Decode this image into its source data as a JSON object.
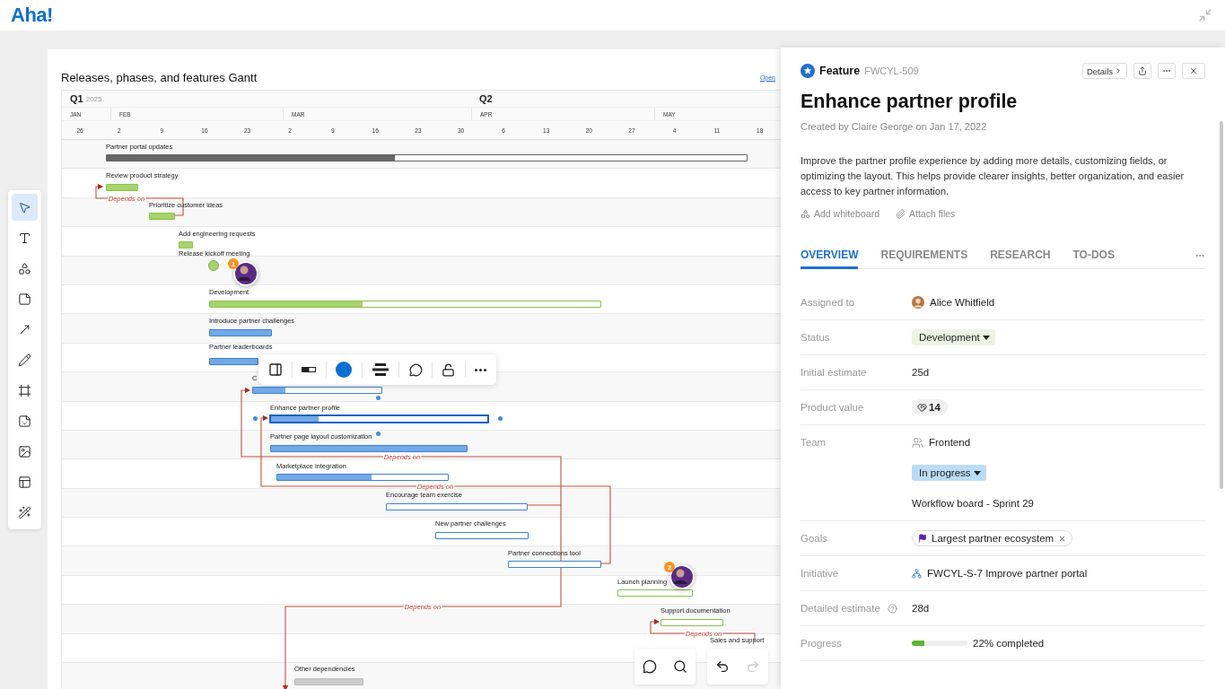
{
  "app": {
    "logo": "Aha!"
  },
  "tools": [
    {
      "selected": true
    },
    {
      "selected": false
    },
    {
      "selected": false
    },
    {
      "selected": false
    },
    {
      "selected": false
    },
    {
      "selected": false
    },
    {
      "selected": false
    },
    {
      "selected": false
    },
    {
      "selected": false
    },
    {
      "selected": false
    },
    {
      "selected": false
    }
  ],
  "gantt": {
    "title": "Releases, phases, and features Gantt",
    "open_link": "Open",
    "quarters": [
      {
        "label": "Q1",
        "year": "2025"
      },
      {
        "label": "Q2"
      }
    ],
    "months": [
      "JAN",
      "FEB",
      "MAR",
      "APR",
      "MAY"
    ],
    "days": [
      "26",
      "2",
      "9",
      "16",
      "23",
      "2",
      "9",
      "16",
      "23",
      "30",
      "6",
      "13",
      "20",
      "27",
      "4",
      "11",
      "18"
    ],
    "items": [
      {
        "label": "Partner portal updates",
        "kind": "release",
        "level": 0.45,
        "selected": false
      },
      {
        "label": "Review product strategy",
        "kind": "phase",
        "level": 1,
        "selected": false
      },
      {
        "label": "Prioritize customer ideas",
        "kind": "phase",
        "level": 1,
        "selected": false
      },
      {
        "label": "Add engineering requests",
        "kind": "phase",
        "level": 1,
        "selected": false
      },
      {
        "label": "Release kickoff meeting",
        "kind": "milestone",
        "badge": "1"
      },
      {
        "label": "Development",
        "kind": "phase",
        "level": 0.39,
        "selected": false
      },
      {
        "label": "Introduce partner challenges",
        "kind": "feature",
        "level": 1,
        "selected": false
      },
      {
        "label": "Partner leaderboards",
        "kind": "feature",
        "level": 1,
        "selected": false
      },
      {
        "label": "C",
        "kind": "feature",
        "level": 0.25,
        "selected": false
      },
      {
        "label": "Enhance partner profile",
        "kind": "feature",
        "level": 0.22,
        "selected": true
      },
      {
        "label": "Partner page layout customization",
        "kind": "feature",
        "level": 1,
        "selected": false
      },
      {
        "label": "Marketplace integration",
        "kind": "feature",
        "level": 0.55,
        "selected": false
      },
      {
        "label": "Encourage team exercise",
        "kind": "feature",
        "level": 0,
        "selected": false
      },
      {
        "label": "New partner challenges",
        "kind": "feature",
        "level": 0,
        "selected": false
      },
      {
        "label": "Partner connections tool",
        "kind": "feature",
        "level": 0,
        "selected": false
      },
      {
        "label": "Launch planning",
        "kind": "phase",
        "level": 0,
        "badge": "2",
        "selected": false
      },
      {
        "label": "Support documentation",
        "kind": "phase",
        "level": 0,
        "selected": false
      },
      {
        "label": "Sales and support",
        "kind": "label"
      },
      {
        "label": "Other dependencies",
        "kind": "other",
        "level": 1,
        "selected": false
      }
    ],
    "dependencies": [
      {
        "label": "Depends on"
      },
      {
        "label": "Depends on"
      },
      {
        "label": "Depends on"
      },
      {
        "label": "Depends on"
      },
      {
        "label": "Depends on"
      }
    ]
  },
  "bar_toolbar": {
    "color": "#0b6fd6"
  },
  "history": {
    "undo_disabled": false,
    "redo_disabled": true
  },
  "panel": {
    "type_label": "Feature",
    "id": "FWCYL-509",
    "details_button": "Details",
    "title": "Enhance partner profile",
    "created": "Created by Claire George on Jan 17, 2022",
    "description": "Improve the partner profile experience by adding more details, customizing fields, or optimizing the layout. This helps provide clearer insights, better organization, and easier access to key partner information.",
    "actions": [
      "Add whiteboard",
      "Attach files"
    ],
    "tabs": [
      {
        "label": "OVERVIEW",
        "selected": true
      },
      {
        "label": "REQUIREMENTS",
        "selected": false
      },
      {
        "label": "RESEARCH",
        "selected": false
      },
      {
        "label": "TO-DOS",
        "selected": false
      }
    ],
    "fields": [
      {
        "kind": "person",
        "label": "Assigned to",
        "value": "Alice Whitfield"
      },
      {
        "kind": "status",
        "label": "Status",
        "value": "Development"
      },
      {
        "kind": "text",
        "label": "Initial estimate",
        "value": "25d"
      },
      {
        "kind": "score",
        "label": "Product value",
        "value": "14"
      },
      {
        "kind": "team",
        "label": "Team",
        "value": "Frontend",
        "workflow_status": "In progress",
        "board": "Workflow board - Sprint 29"
      },
      {
        "kind": "goal",
        "label": "Goals",
        "value": "Largest partner ecosystem"
      },
      {
        "kind": "initiative",
        "label": "Initiative",
        "value": "FWCYL-S-7 Improve partner portal"
      },
      {
        "kind": "estimate",
        "label": "Detailed estimate",
        "value": "28d"
      },
      {
        "kind": "progress",
        "label": "Progress",
        "level": 0.22,
        "value": "22% completed"
      }
    ]
  }
}
